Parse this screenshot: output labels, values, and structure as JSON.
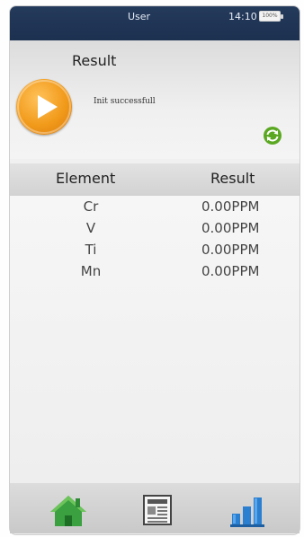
{
  "status_bar": {
    "user": "User",
    "time": "14:10",
    "battery": "100%"
  },
  "header": {
    "title": "Result",
    "message": "Init successfull"
  },
  "table": {
    "columns": [
      "Element",
      "Result"
    ],
    "rows": [
      {
        "element": "Cr",
        "result": "0.00PPM"
      },
      {
        "element": "V",
        "result": "0.00PPM"
      },
      {
        "element": "Ti",
        "result": "0.00PPM"
      },
      {
        "element": "Mn",
        "result": "0.00PPM"
      }
    ]
  },
  "colors": {
    "status_bar": "#1f3454",
    "play_orange": "#f19a1a",
    "home_green": "#3aa040",
    "results_blue": "#2a7fd1",
    "refresh_green": "#5aa821"
  },
  "icons": {
    "play": "play-icon",
    "refresh": "refresh-icon",
    "home": "home-icon",
    "report": "report-icon",
    "results": "bar-chart-icon",
    "battery": "battery-icon"
  }
}
